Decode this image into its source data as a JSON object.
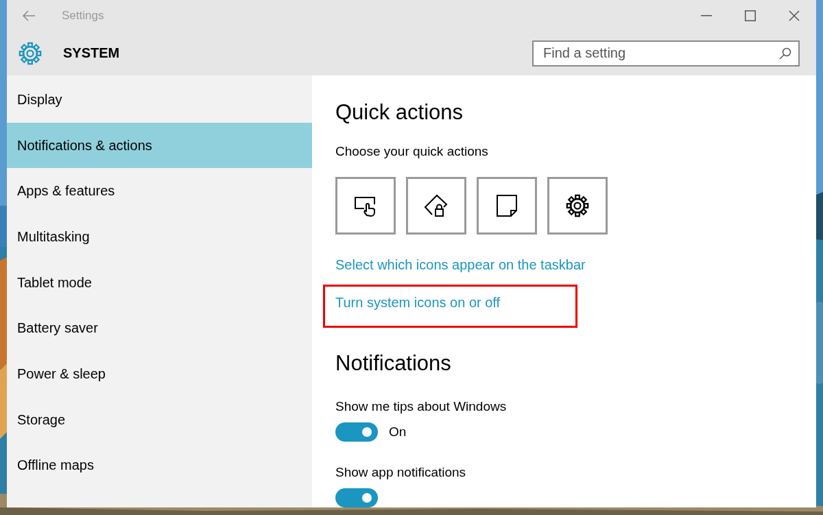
{
  "window": {
    "title": "Settings"
  },
  "header": {
    "title": "SYSTEM"
  },
  "search": {
    "placeholder": "Find a setting"
  },
  "sidebar": {
    "items": [
      {
        "label": "Display",
        "selected": false
      },
      {
        "label": "Notifications & actions",
        "selected": true
      },
      {
        "label": "Apps & features",
        "selected": false
      },
      {
        "label": "Multitasking",
        "selected": false
      },
      {
        "label": "Tablet mode",
        "selected": false
      },
      {
        "label": "Battery saver",
        "selected": false
      },
      {
        "label": "Power & sleep",
        "selected": false
      },
      {
        "label": "Storage",
        "selected": false
      },
      {
        "label": "Offline maps",
        "selected": false
      }
    ]
  },
  "quick_actions": {
    "heading": "Quick actions",
    "subtitle": "Choose your quick actions",
    "tiles": [
      {
        "kind": "tablet"
      },
      {
        "kind": "rotation-lock"
      },
      {
        "kind": "note"
      },
      {
        "kind": "settings"
      }
    ]
  },
  "links": [
    {
      "label": "Select which icons appear on the taskbar",
      "highlighted": false
    },
    {
      "label": "Turn system icons on or off",
      "highlighted": true
    }
  ],
  "notifications": {
    "heading": "Notifications",
    "settings": [
      {
        "label": "Show me tips about Windows",
        "on": true,
        "state_label": "On"
      },
      {
        "label": "Show app notifications",
        "on": true
      }
    ]
  }
}
